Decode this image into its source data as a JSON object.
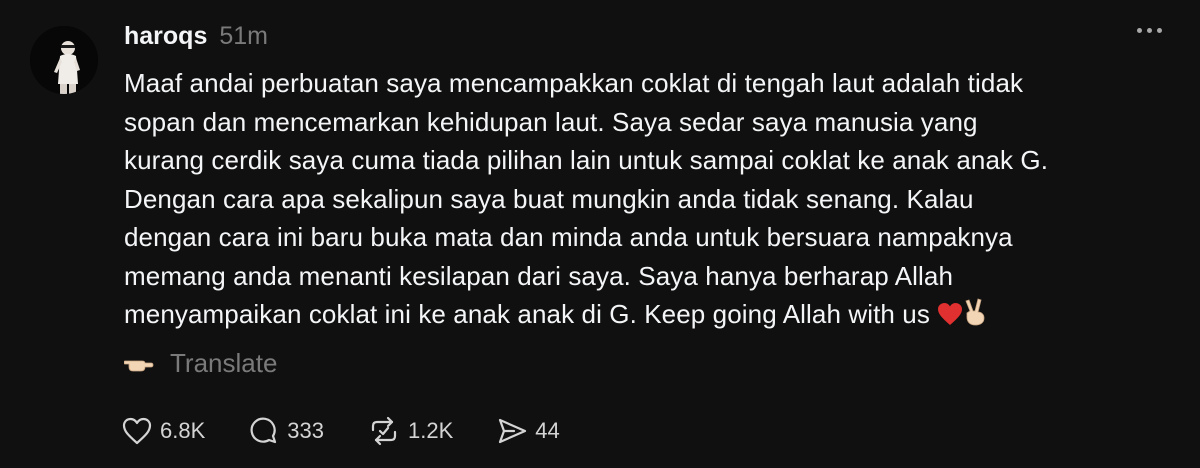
{
  "post": {
    "username": "haroqs",
    "timestamp": "51m",
    "text_lines": [
      "Maaf andai perbuatan saya mencampakkan coklat di tengah laut adalah tidak",
      "sopan dan mencemarkan kehidupan laut. Saya sedar saya manusia yang",
      "kurang cerdik saya cuma tiada pilihan lain untuk sampai coklat ke anak anak G.",
      "Dengan cara apa sekalipun saya buat mungkin anda tidak senang. Kalau",
      "dengan cara ini baru buka mata dan minda anda untuk bersuara nampaknya",
      "memang anda menanti kesilapan dari saya. Saya hanya berharap Allah",
      "menyampaikan coklat ini ke anak anak di G. Keep going Allah with us"
    ],
    "trailing_emojis": [
      "heart-emoji",
      "victory-hand-emoji"
    ],
    "translate_label": "Translate"
  },
  "actions": {
    "likes": "6.8K",
    "replies": "333",
    "reposts": "1.2K",
    "shares": "44"
  },
  "colors": {
    "background": "#101010",
    "text": "#f3f5f7",
    "secondary": "#7a7a7a",
    "heart": "#e0302f"
  }
}
